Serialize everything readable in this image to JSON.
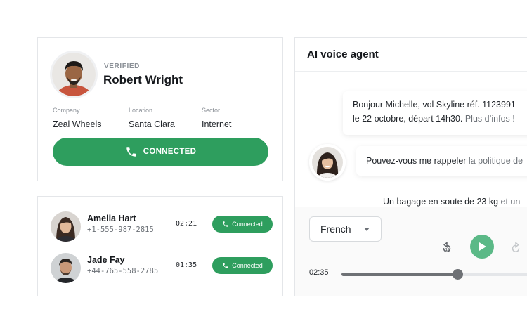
{
  "profile": {
    "verified_label": "VERIFIED",
    "name": "Robert Wright",
    "fields": [
      {
        "label": "Company",
        "value": "Zeal Wheels"
      },
      {
        "label": "Location",
        "value": "Santa Clara"
      },
      {
        "label": "Sector",
        "value": "Internet"
      }
    ],
    "connect_label": "CONNECTED",
    "avatar_icon": "person-avatar",
    "accent_color": "#2e9e5e"
  },
  "calls": [
    {
      "name": "Amelia Hart",
      "phone": "+1-555-987-2815",
      "duration": "02:21",
      "status": "Connected"
    },
    {
      "name": "Jade Fay",
      "phone": "+44-765-558-2785",
      "duration": "01:35",
      "status": "Connected"
    }
  ],
  "agent": {
    "title": "AI voice agent",
    "message_1_line_1": "Bonjour Michelle, vol Skyline réf. 1123991",
    "message_1_line_2_main": "le 22 octobre, départ 14h30.",
    "message_1_line_2_muted": " Plus d’infos !",
    "message_2_main": "Pouvez-vous me rappeler",
    "message_2_muted": " la politique de",
    "message_3_main": "Un bagage en soute de 23 kg",
    "message_3_muted": " et un",
    "player": {
      "language": "French",
      "current_time": "02:35",
      "progress": 0.55
    }
  }
}
